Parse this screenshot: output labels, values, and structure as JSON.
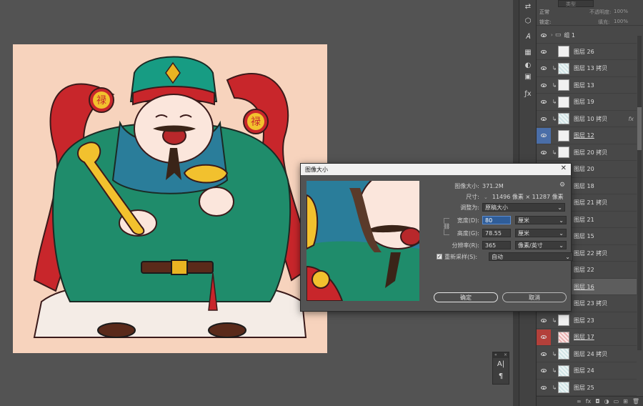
{
  "layers_panel": {
    "search_placeholder": "类型",
    "blend_mode": "正常",
    "opacity_label": "不透明度:",
    "opacity_value": "100%",
    "lock_label": "锁定:",
    "fill_label": "填充:",
    "fill_value": "100%",
    "group_name": "组 1",
    "layers": [
      {
        "name": "图层 26",
        "clip": false,
        "thumb": "plain",
        "state": "",
        "fx": false
      },
      {
        "name": "图层 13 拷贝",
        "clip": true,
        "thumb": "pattern",
        "state": "",
        "fx": false
      },
      {
        "name": "图层 13",
        "clip": true,
        "thumb": "plain",
        "state": "",
        "fx": false
      },
      {
        "name": "图层 19",
        "clip": true,
        "thumb": "plain",
        "state": "",
        "fx": false
      },
      {
        "name": "图层 10 拷贝",
        "clip": true,
        "thumb": "pattern",
        "state": "",
        "fx": true
      },
      {
        "name": "图层 12",
        "clip": false,
        "thumb": "plain",
        "state": "sel-blue",
        "fx": false
      },
      {
        "name": "图层 20 拷贝",
        "clip": true,
        "thumb": "plain",
        "state": "",
        "fx": false
      },
      {
        "name": "图层 20",
        "clip": true,
        "thumb": "plain",
        "state": "",
        "fx": false
      },
      {
        "name": "图层 18",
        "clip": true,
        "thumb": "plain",
        "state": "",
        "fx": false
      },
      {
        "name": "图层 21 拷贝",
        "clip": true,
        "thumb": "plain",
        "state": "",
        "fx": false
      },
      {
        "name": "图层 21",
        "clip": true,
        "thumb": "plain",
        "state": "",
        "fx": false
      },
      {
        "name": "图层 15",
        "clip": false,
        "thumb": "plain",
        "state": "",
        "fx": false
      },
      {
        "name": "图层 22 拷贝",
        "clip": true,
        "thumb": "plain",
        "state": "",
        "fx": false
      },
      {
        "name": "图层 22",
        "clip": true,
        "thumb": "plain",
        "state": "",
        "fx": false
      },
      {
        "name": "图层 16",
        "clip": false,
        "thumb": "plain",
        "state": "hover",
        "fx": false
      },
      {
        "name": "图层 23 拷贝",
        "clip": true,
        "thumb": "plain",
        "state": "",
        "fx": false
      },
      {
        "name": "图层 23",
        "clip": true,
        "thumb": "plain",
        "state": "",
        "fx": false
      },
      {
        "name": "图层 17",
        "clip": false,
        "thumb": "red",
        "state": "sel-red",
        "fx": false
      },
      {
        "name": "图层 24 拷贝",
        "clip": true,
        "thumb": "pattern",
        "state": "",
        "fx": false
      },
      {
        "name": "图层 24",
        "clip": true,
        "thumb": "pattern",
        "state": "",
        "fx": false
      },
      {
        "name": "图层 25",
        "clip": true,
        "thumb": "pattern",
        "state": "",
        "fx": false
      }
    ],
    "fx_label": "fx"
  },
  "dialog": {
    "title": "图像大小",
    "image_size_label": "图像大小:",
    "image_size_value": "371.2M",
    "dimensions_label": "尺寸:",
    "dimensions_value": "11496 像素 × 11287 像素",
    "fit_label": "调整为:",
    "fit_value": "原稿大小",
    "width_label": "宽度(D):",
    "width_value": "80",
    "width_unit": "厘米",
    "height_label": "高度(G):",
    "height_value": "78.55",
    "height_unit": "厘米",
    "resolution_label": "分辨率(R):",
    "resolution_value": "365",
    "resolution_unit": "像素/英寸",
    "resample_label": "重新采样(S):",
    "resample_checked": true,
    "resample_value": "自动",
    "ok_label": "确定",
    "cancel_label": "取消"
  },
  "artwork": {
    "badge_char": "禄"
  },
  "colors": {
    "canvas_bg": "#f7d3bd",
    "robe_green": "#1f8c6b",
    "robe_red": "#c8262b",
    "gold": "#e9b422",
    "selected_layer": "#4a6ea8",
    "red_layer": "#b3403a"
  },
  "mini_panel": {
    "icons": [
      "text-tool-icon",
      "paragraph-icon"
    ],
    "text_glyph": "A|",
    "para_glyph": "¶"
  }
}
